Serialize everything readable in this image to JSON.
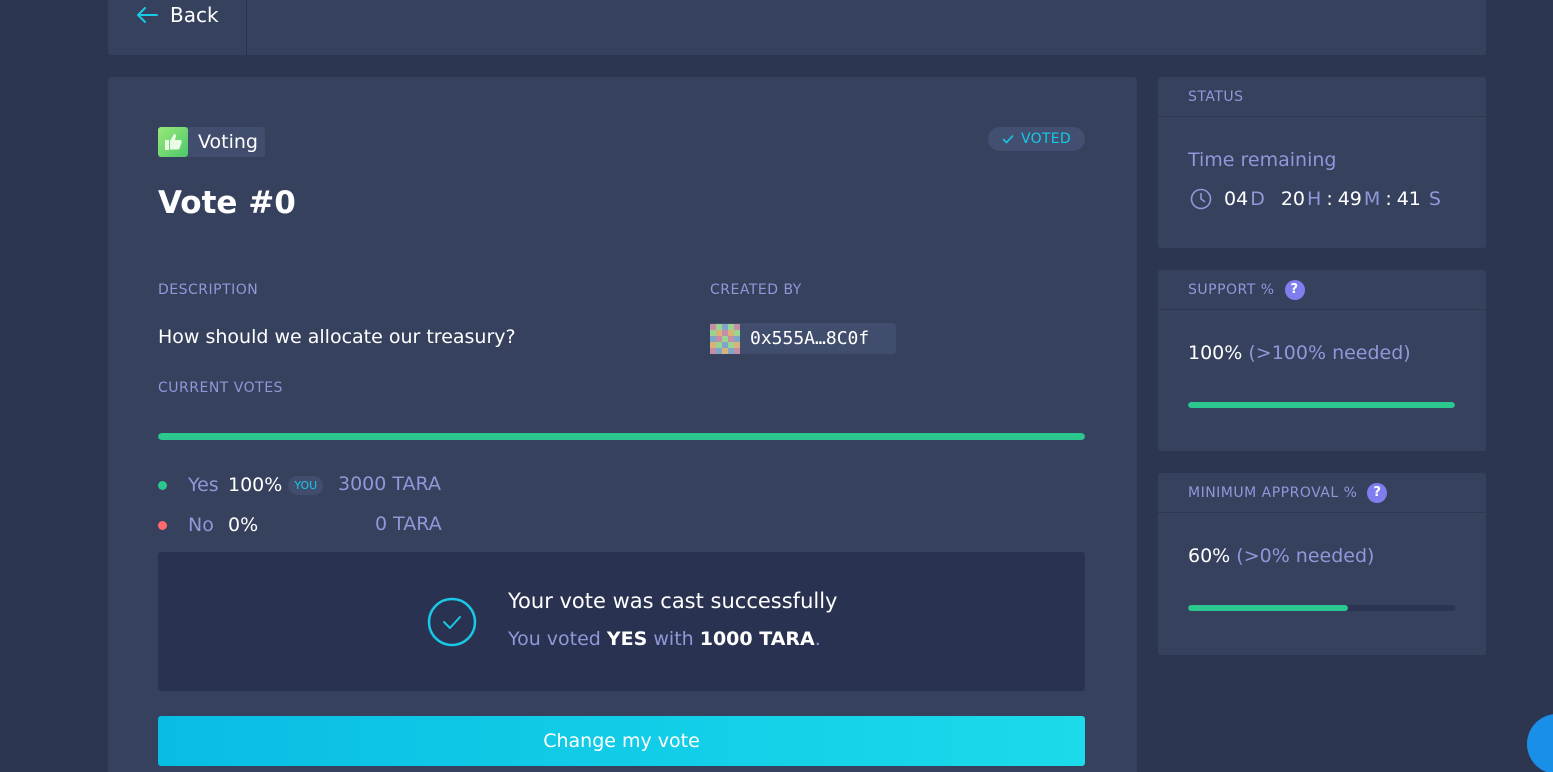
{
  "nav": {
    "back_label": "Back"
  },
  "vote": {
    "app_name": "Voting",
    "status_badge": "VOTED",
    "title": "Vote #0",
    "description_label": "DESCRIPTION",
    "description": "How should we allocate our treasury?",
    "created_by_label": "CREATED BY",
    "creator_address": "0x555A…8C0f",
    "current_votes_label": "CURRENT VOTES",
    "overall_yes_fraction": 1.0,
    "options": [
      {
        "label": "Yes",
        "percent": "100%",
        "you_badge": "YOU",
        "amount": "3000 TARA",
        "color": "#2cc68f"
      },
      {
        "label": "No",
        "percent": "0%",
        "amount": "0 TARA",
        "color": "#ff6b6b"
      }
    ],
    "success": {
      "title": "Your vote was cast successfully",
      "sub_prefix": "You voted",
      "sub_choice": "YES",
      "sub_with": "with",
      "sub_amount": "1000 TARA",
      "sub_period": "."
    },
    "change_button": "Change my vote"
  },
  "sidebar": {
    "status": {
      "heading": "STATUS",
      "time_label": "Time remaining",
      "days": "04",
      "days_unit": "D",
      "hours": "20",
      "hours_unit": "H",
      "minutes": "49",
      "minutes_unit": "M",
      "seconds": "41",
      "seconds_unit": "S",
      "sep": ":"
    },
    "support": {
      "heading": "SUPPORT %",
      "value": "100%",
      "needed": "(>100% needed)",
      "fraction": 1.0
    },
    "approval": {
      "heading": "MINIMUM APPROVAL %",
      "value": "60%",
      "needed": "(>0% needed)",
      "fraction": 0.6
    }
  },
  "colors": {
    "accent": "#18c8e6",
    "success_green": "#2cc68f",
    "no_red": "#ff6b6b",
    "muted_text": "#8f98d8",
    "card_bg": "#36415e",
    "page_bg": "#2c3651"
  }
}
